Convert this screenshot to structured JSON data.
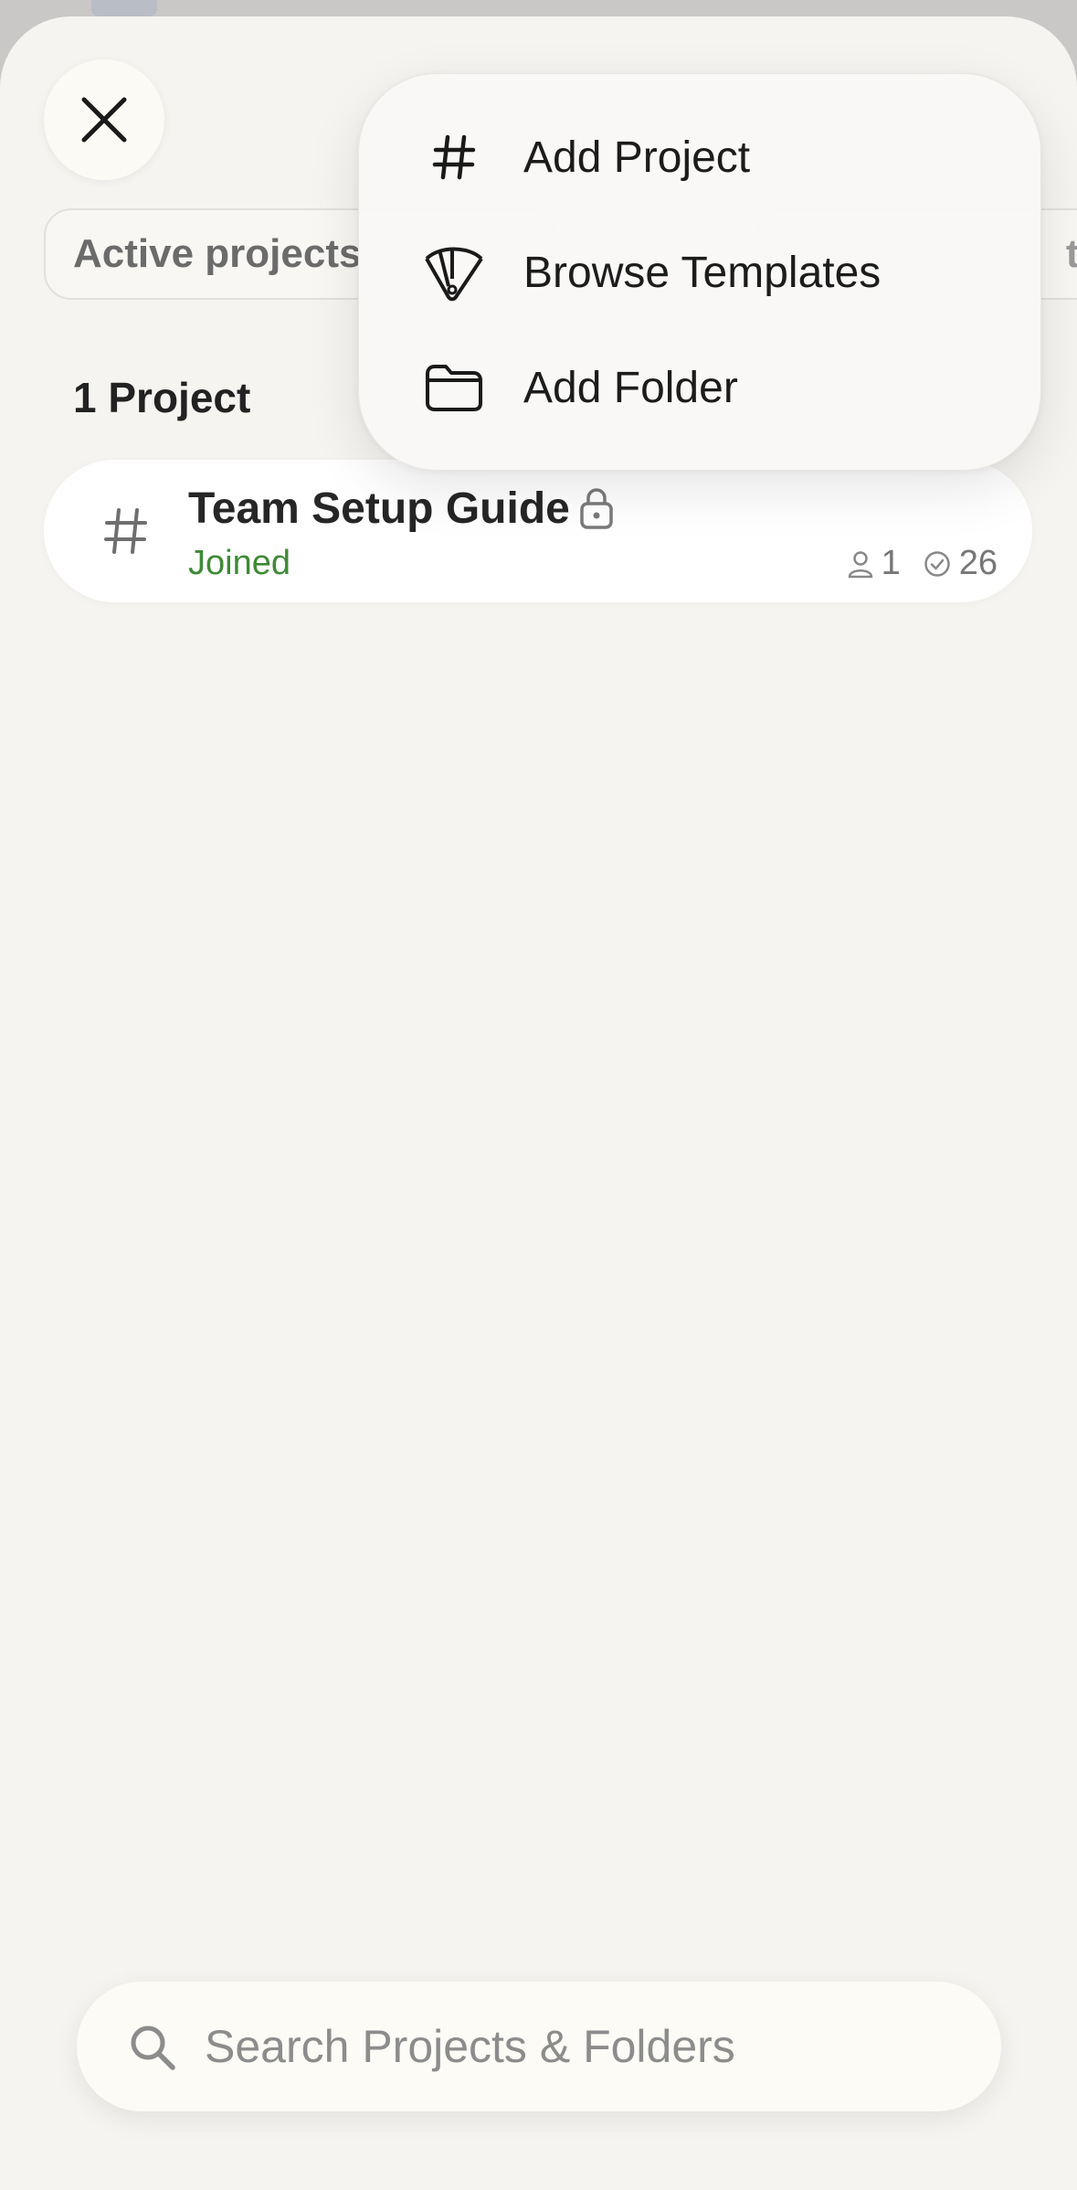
{
  "header": {
    "close_icon": "close-icon"
  },
  "filters": {
    "active_label": "Active projects",
    "second_partial": "t j"
  },
  "section": {
    "title": "1 Project"
  },
  "projects": [
    {
      "icon": "hash-icon",
      "name": "Team Setup Guide",
      "locked": true,
      "status": "Joined",
      "members": "1",
      "tasks": "26"
    }
  ],
  "menu": {
    "items": [
      {
        "icon": "hash-icon",
        "label": "Add Project"
      },
      {
        "icon": "templates-icon",
        "label": "Browse Templates"
      },
      {
        "icon": "folder-icon",
        "label": "Add Folder"
      }
    ]
  },
  "search": {
    "placeholder": "Search Projects & Folders",
    "value": ""
  },
  "colors": {
    "background": "#f5f4f1",
    "joined_green": "#3e8a36",
    "text_dark": "#1c1c1c"
  }
}
